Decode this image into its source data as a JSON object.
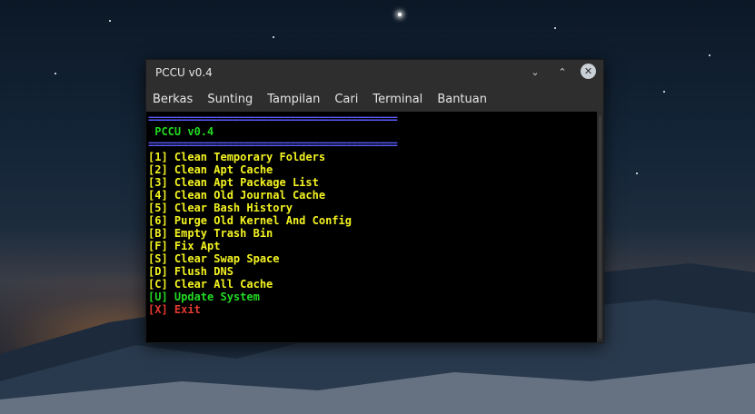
{
  "window": {
    "title": "PCCU v0.4",
    "controls": {
      "minimize": "⌄",
      "maximize": "⌃",
      "close": "✕"
    }
  },
  "menubar": {
    "items": [
      "Berkas",
      "Sunting",
      "Tampilan",
      "Cari",
      "Terminal",
      "Bantuan"
    ]
  },
  "terminal": {
    "separator": "============================================",
    "header": " PCCU v0.4",
    "menu": [
      {
        "key": "[1]",
        "label": "Clean Temporary Folders",
        "color": "#f3f321"
      },
      {
        "key": "[2]",
        "label": "Clean Apt Cache",
        "color": "#f3f321"
      },
      {
        "key": "[3]",
        "label": "Clean Apt Package List",
        "color": "#f3f321"
      },
      {
        "key": "[4]",
        "label": "Clean Old Journal Cache",
        "color": "#f3f321"
      },
      {
        "key": "[5]",
        "label": "Clear Bash History",
        "color": "#f3f321"
      },
      {
        "key": "[6]",
        "label": "Purge Old Kernel And Config",
        "color": "#f3f321"
      },
      {
        "key": "[B]",
        "label": "Empty Trash Bin",
        "color": "#f3f321"
      },
      {
        "key": "[F]",
        "label": "Fix Apt",
        "color": "#f3f321"
      },
      {
        "key": "[S]",
        "label": "Clear Swap Space",
        "color": "#f3f321"
      },
      {
        "key": "[D]",
        "label": "Flush DNS",
        "color": "#f3f321"
      },
      {
        "key": "[C]",
        "label": "Clear All Cache",
        "color": "#f3f321"
      },
      {
        "key": "[U]",
        "label": "Update System",
        "color": "#22d822"
      },
      {
        "key": "[X]",
        "label": "Exit",
        "color": "#e43a30"
      }
    ]
  },
  "colors": {
    "separator": "#5a5cff",
    "header": "#22d822",
    "background": "#000000"
  }
}
